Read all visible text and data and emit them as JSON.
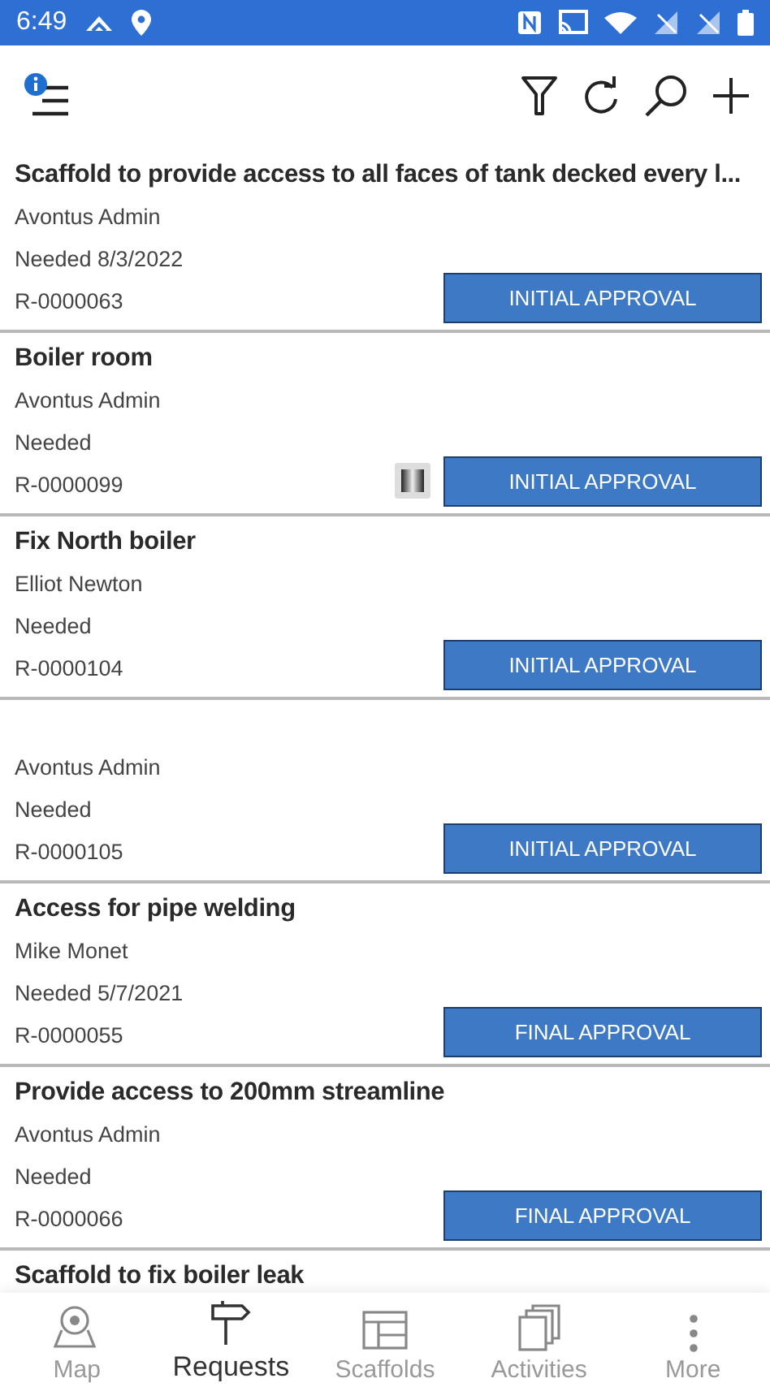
{
  "status_bar": {
    "time": "6:49"
  },
  "requests": [
    {
      "title": "Scaffold to provide access to all faces of tank decked every l...",
      "requester": "Avontus Admin",
      "needed": "Needed 8/3/2022",
      "number": "R-0000063",
      "action": "INITIAL APPROVAL",
      "has_attachment": false
    },
    {
      "title": "Boiler room",
      "requester": "Avontus Admin",
      "needed": "Needed",
      "number": "R-0000099",
      "action": "INITIAL APPROVAL",
      "has_attachment": true
    },
    {
      "title": "Fix North boiler",
      "requester": "Elliot Newton",
      "needed": "Needed",
      "number": "R-0000104",
      "action": "INITIAL APPROVAL",
      "has_attachment": false
    },
    {
      "requester": "Avontus Admin",
      "needed": "Needed",
      "number": "R-0000105",
      "action": "INITIAL APPROVAL",
      "has_attachment": false
    },
    {
      "title": "Access for pipe welding",
      "requester": "Mike Monet",
      "needed": "Needed 5/7/2021",
      "number": "R-0000055",
      "action": "FINAL APPROVAL",
      "has_attachment": false
    },
    {
      "title": "Provide access to 200mm streamline",
      "requester": "Avontus Admin",
      "needed": "Needed",
      "number": "R-0000066",
      "action": "FINAL APPROVAL",
      "has_attachment": false
    },
    {
      "title": "Scaffold to fix boiler leak"
    }
  ],
  "nav": [
    {
      "kind": "map",
      "label": "Map",
      "selected": false
    },
    {
      "kind": "requests",
      "label": "Requests",
      "selected": true
    },
    {
      "kind": "scaffolds",
      "label": "Scaffolds",
      "selected": false
    },
    {
      "kind": "activities",
      "label": "Activities",
      "selected": false
    },
    {
      "kind": "more",
      "label": "More",
      "selected": false
    }
  ]
}
